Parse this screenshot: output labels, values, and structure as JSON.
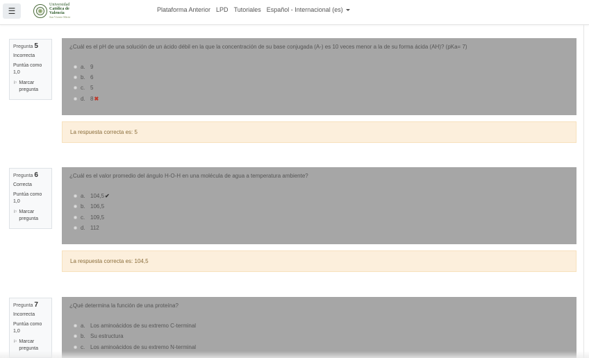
{
  "navbar": {
    "logo": {
      "line1": "Universidad",
      "line2": "Católica de",
      "line3": "Valencia",
      "line4": "San Vicente Mártir"
    },
    "links": [
      "Plataforma Anterior",
      "LPD",
      "Tutoriales"
    ],
    "language": "Español - Internacional (es)"
  },
  "questions": [
    {
      "label": "Pregunta",
      "number": "5",
      "state": "Incorrecta",
      "grade_label": "Puntúa como",
      "grade_value": "1,0",
      "flag_line1": "Marcar",
      "flag_line2": "pregunta",
      "text": "¿Cuál es el pH de una solución de un ácido débil en la que la concentración de su base conjugada (A-) es 10 veces menor a la de su forma ácida (AH)? (pKa= 7)",
      "options": [
        {
          "letter": "a.",
          "text": "9",
          "mark": ""
        },
        {
          "letter": "b.",
          "text": "6",
          "mark": ""
        },
        {
          "letter": "c.",
          "text": "5",
          "mark": ""
        },
        {
          "letter": "d.",
          "text": "8",
          "mark": "✖"
        }
      ],
      "feedback": "La respuesta correcta es: 5"
    },
    {
      "label": "Pregunta",
      "number": "6",
      "state": "Correcta",
      "grade_label": "Puntúa como",
      "grade_value": "1,0",
      "flag_line1": "Marcar",
      "flag_line2": "pregunta",
      "text": "¿Cuál es el valor promedio del ángulo H-O-H en una molécula de agua a temperatura ambiente?",
      "options": [
        {
          "letter": "a.",
          "text": "104,5",
          "mark": "✔"
        },
        {
          "letter": "b.",
          "text": "106,5",
          "mark": ""
        },
        {
          "letter": "c.",
          "text": "109,5",
          "mark": ""
        },
        {
          "letter": "d.",
          "text": "112",
          "mark": ""
        }
      ],
      "feedback": "La respuesta correcta es: 104,5"
    },
    {
      "label": "Pregunta",
      "number": "7",
      "state": "Incorrecta",
      "grade_label": "Puntúa como",
      "grade_value": "1,0",
      "flag_line1": "Marcar",
      "flag_line2": "pregunta",
      "text": "¿Qué determina la función de una proteína?",
      "options": [
        {
          "letter": "a.",
          "text": "Los aminoácidos de su extremo C-terminal",
          "mark": ""
        },
        {
          "letter": "b.",
          "text": "Su estructura",
          "mark": ""
        },
        {
          "letter": "c.",
          "text": "Los aminoácidos de su extremo N-terminal",
          "mark": ""
        }
      ]
    }
  ],
  "colors": {
    "question_bg": "#a6a6a6",
    "feedback_bg": "#fcefdc",
    "feedback_text": "#8a6d3b",
    "incorrect": "#c0392b"
  }
}
